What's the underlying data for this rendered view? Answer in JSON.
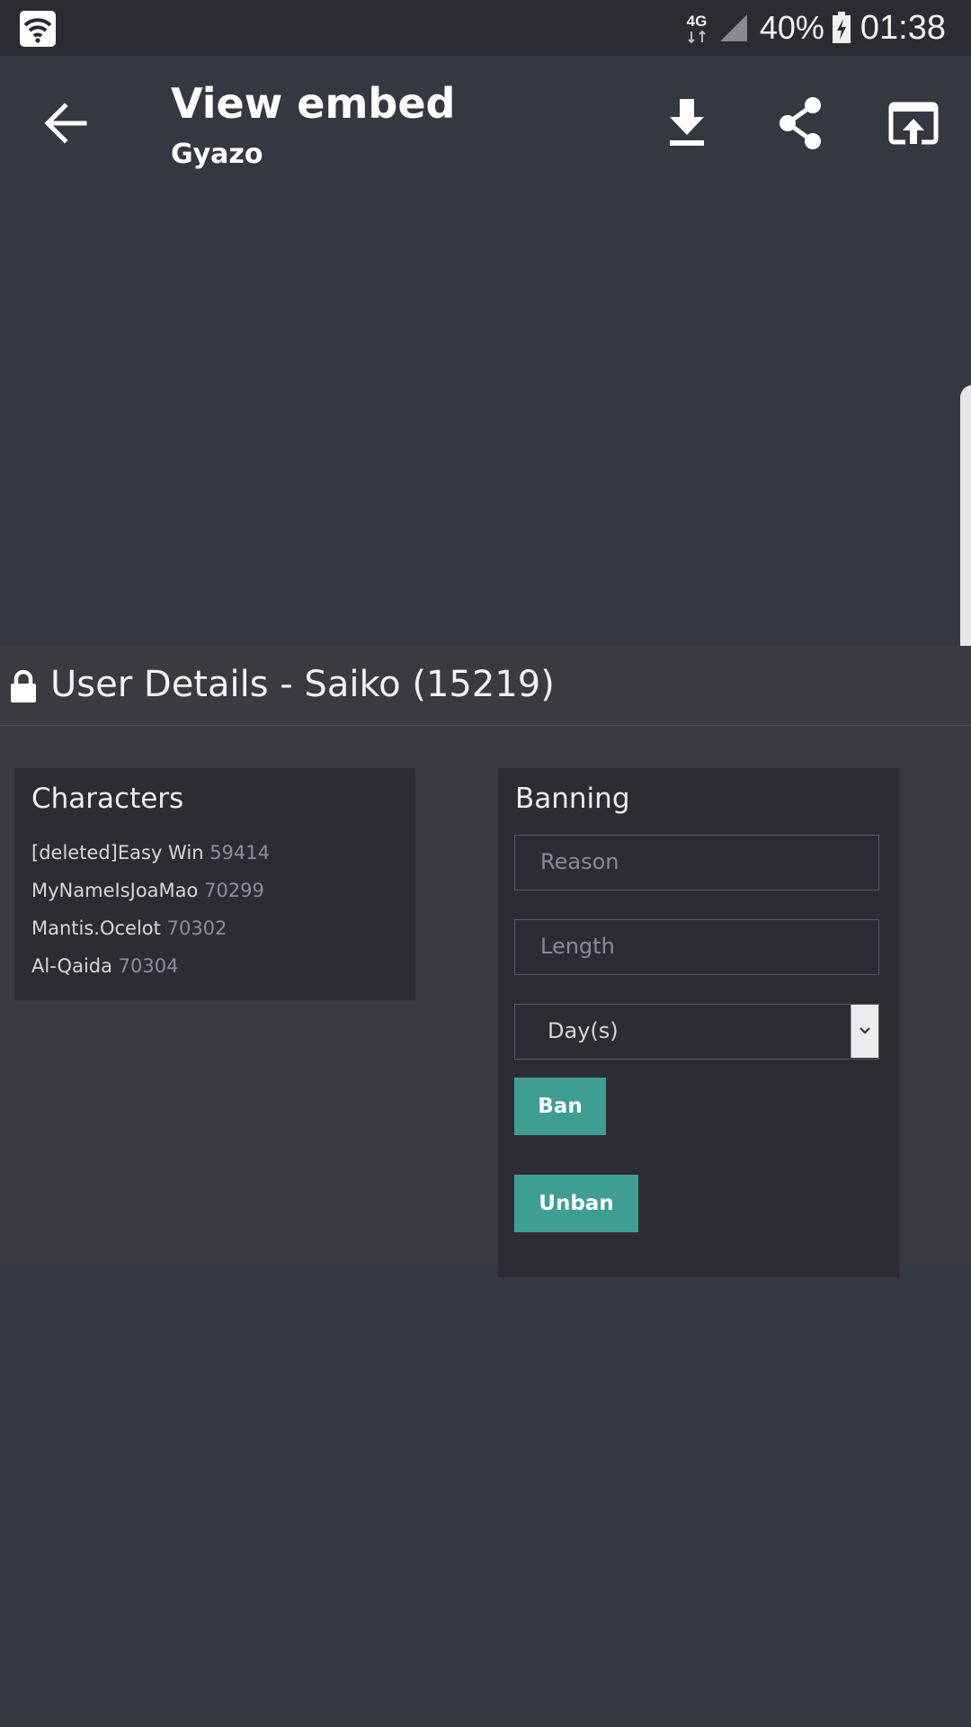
{
  "status_bar": {
    "network_type": "4G",
    "battery_percent": "40%",
    "time": "01:38"
  },
  "app_bar": {
    "title": "View embed",
    "subtitle": "Gyazo"
  },
  "icons": {
    "status_app": "wifi-icon",
    "back": "arrow-back-icon",
    "download": "download-icon",
    "share": "share-icon",
    "open_external": "open-in-browser-icon",
    "lock": "lock-icon",
    "select_arrow": "chevron-down-icon"
  },
  "embed": {
    "page_title": "User Details - Saiko (15219)",
    "characters": {
      "title": "Characters",
      "items": [
        {
          "name": "[deleted]Easy Win",
          "id": "59414"
        },
        {
          "name": "MyNameIsJoaMao",
          "id": "70299"
        },
        {
          "name": "Mantis.Ocelot",
          "id": "70302"
        },
        {
          "name": "Al-Qaida",
          "id": "70304"
        }
      ]
    },
    "banning": {
      "title": "Banning",
      "reason_placeholder": "Reason",
      "length_placeholder": "Length",
      "unit_selected": "Day(s)",
      "ban_label": "Ban",
      "unban_label": "Unban"
    }
  },
  "colors": {
    "background": "#363841",
    "status_bar": "#2a2c31",
    "embed_background": "#3c393f",
    "panel": "#2e2c32",
    "button": "#3e9e91"
  }
}
